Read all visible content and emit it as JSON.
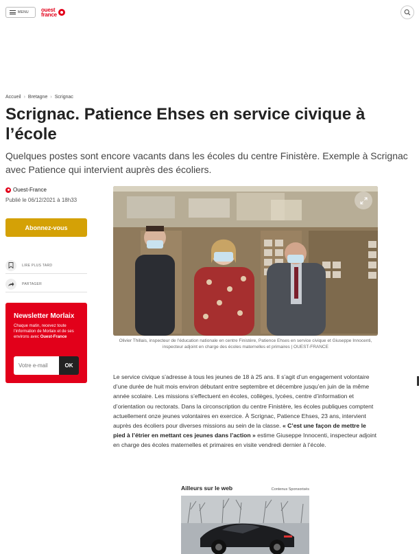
{
  "header": {
    "menu_label": "MENU",
    "logo_line1": "ouest",
    "logo_line2": "france"
  },
  "breadcrumb": [
    "Accueil",
    "Bretagne",
    "Scrignac"
  ],
  "article": {
    "title": "Scrignac. Patience Ehses en service civique à l’école",
    "lede": "Quelques postes sont encore vacants dans les écoles du centre Finistère. Exemple à Scrignac avec Patience qui intervient auprès des écoliers.",
    "source": "Ouest-France",
    "published": "Publié le 06/12/2021 à 18h33",
    "caption": "Olivier Thillais, inspecteur de l’éducation nationale en centre Finistère, Patience Ehses en service civique et Giuseppe Innocenti, inspecteur adjoint en charge des écoles maternelles et primaires | OUEST-FRANCE",
    "body_part1": "Le service civique s’adresse à tous les jeunes de 18 à 25 ans. Il s’agit d’un engagement volontaire d’une durée de huit mois environ débutant entre septembre et décembre jusqu’en juin de la même année scolaire. Les missions s’effectuent en écoles, collèges, lycées, centre d’information et d’orientation ou rectorats. Dans la circonscription du centre Finistère, les écoles publiques comptent actuellement onze jeunes volontaires en exercice. À Scrignac, Patience Ehses, 23 ans, intervient auprès des écoliers pour diverses missions au sein de la classe. ",
    "body_quote": "« C’est une façon de mettre le pied à l’étrier en mettant ces jeunes dans l’action »",
    "body_part2": " estime Giuseppe Innocenti, inspecteur adjoint en charge des écoles maternelles et primaires en visite vendredi dernier à l’école."
  },
  "sidebar": {
    "subscribe_label": "Abonnez-vous",
    "read_later_label": "LIRE PLUS TARD",
    "share_label": "PARTAGER",
    "newsletter_title": "Newsletter Morlaix",
    "newsletter_text": "Chaque matin, recevez toute l’information de Morlaix et de ses environs avec",
    "newsletter_brand": "Ouest-France",
    "email_placeholder": "Votre e-mail",
    "ok_label": "OK"
  },
  "sponsored": {
    "title": "Ailleurs sur le web",
    "tag": "Contenus Sponsorisés"
  },
  "colors": {
    "brand_red": "#e2001a",
    "subscribe_gold": "#d4a106"
  },
  "icons": [
    "menu-icon",
    "search-icon",
    "bookmark-icon",
    "share-icon",
    "expand-icon"
  ]
}
